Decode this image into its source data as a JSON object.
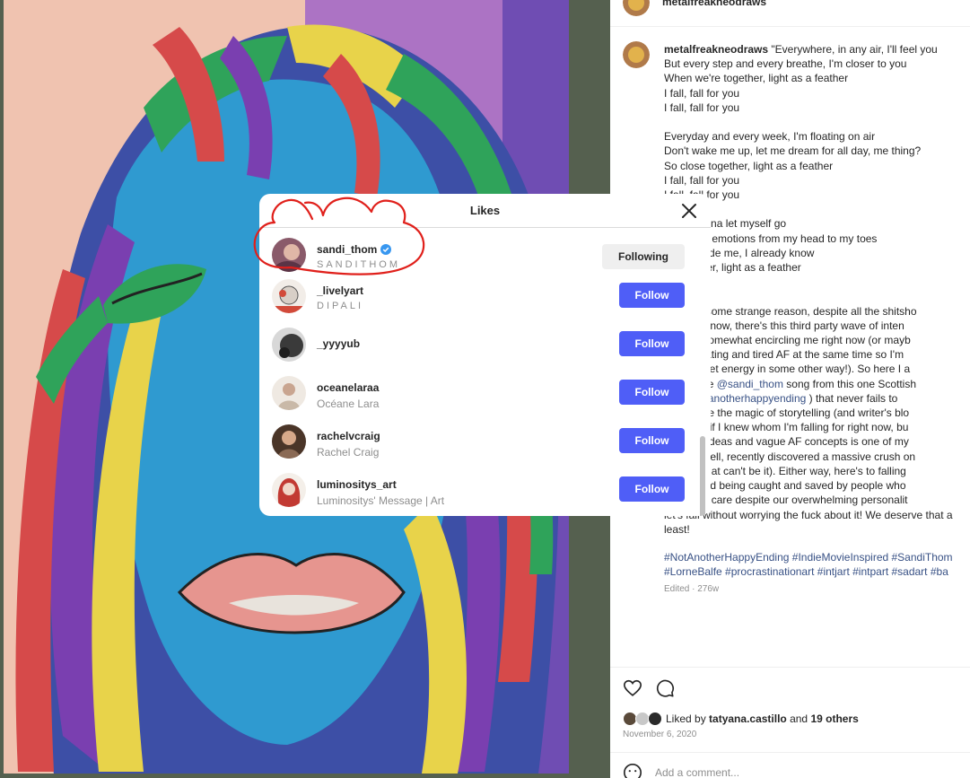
{
  "post": {
    "username": "metalfreakneodraws",
    "caption": "\"Everywhere, in any air, I'll feel you\nBut every step and every breathe, I'm closer to you\nWhen we're together, light as a feather\nI fall, fall for you\nI fall, fall for you\n\nEveryday and every week, I'm floating on air\nDon't wake me up, let me dream for all day, me thing?\nSo close together, light as a feather\nI fall, fall for you\nI fall, fall for you\n\nme, I wanna let myself go\na life with emotions from my head to my toes\ndown inside me, I already know\nre together, light as a feather\nor you\"\n\nause for some strange reason, despite all the shitsho\nis in right now, there's this third party wave of inten\nardor is somewhat encircling me right now (or mayb\nrocrastinating and tired AF at the same time so I'm\ng my regret energy in some other way!). So here I a\nto this one",
    "mention_1": "@sandi_thom",
    "caption_mid": " song from this one Scottish\nie ( ",
    "mention_2": "@notanotherhappyending",
    "caption_end": " ) that never fails to\nappreciate the magic of storytelling (and writer's blo\nbe better if I knew whom I'm falling for right now, bu\nove with ideas and vague AF concepts is one of my\nastime (well, recently discovered a massive crush on\nney but that can't be it). Either way, here's to falling\nspirals and being caught and saved by people who\nut us and care despite our overwhelming personalit\nlet's fall without worrying the fuck about it! We deserve that a\nleast!",
    "hashtags": "#NotAnotherHappyEnding #IndieMovieInspired #SandiThom\n#LorneBalfe #procrastinationart #intjart #intpart #sadart #ba",
    "edited": "Edited · 276w",
    "liked_by_prefix": "Liked by ",
    "liked_by_user": "tatyana.castillo",
    "liked_by_mid": " and ",
    "liked_by_others": "19 others",
    "date": "November 6, 2020",
    "comment_placeholder": "Add a comment..."
  },
  "modal": {
    "title": "Likes",
    "users": [
      {
        "username": "sandi_thom",
        "subtitle": "SANDITHOM",
        "verified": true,
        "button": "Following",
        "avatar_color": "#8a5a6a"
      },
      {
        "username": "_livelyart",
        "subtitle": "DIPALI",
        "verified": false,
        "button": "Follow",
        "avatar_color": "#d8cfc7"
      },
      {
        "username": "_yyyyub",
        "subtitle": "",
        "verified": false,
        "button": "Follow",
        "avatar_color": "#3a3a3a"
      },
      {
        "username": "oceanelaraa",
        "subtitle": "Océane Lara",
        "verified": false,
        "button": "Follow",
        "avatar_color": "#c9b9a8"
      },
      {
        "username": "rachelvcraig",
        "subtitle": "Rachel Craig",
        "verified": false,
        "button": "Follow",
        "avatar_color": "#6b4a35"
      },
      {
        "username": "luminositys_art",
        "subtitle": "Luminositys' Message | Art",
        "verified": false,
        "button": "Follow",
        "avatar_color": "#b83a3a"
      }
    ]
  },
  "colors": {
    "follow_button": "#4f5ef7",
    "following_button": "#efefef",
    "link": "#385185",
    "annotation": "#e0201b",
    "verified": "#3897f0"
  }
}
